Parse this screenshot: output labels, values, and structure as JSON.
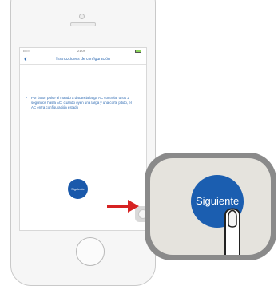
{
  "status_bar": {
    "signal": "••••○ ",
    "time": "21:09"
  },
  "nav": {
    "title": "Instrucciones de configuración"
  },
  "instruction": {
    "bullet": "•",
    "text": "Por favor, pulse el mando a distancia larga AC controlar unos 2 segundos hasta AC, cuando oyen una larga y una corte pitido, el AC entra configuración estado"
  },
  "buttons": {
    "next_small": "Siguiente",
    "next_large": "Siguiente"
  },
  "colors": {
    "accent": "#1a59ab",
    "arrow": "#d62222"
  },
  "icons": [
    "back-icon",
    "battery-icon",
    "assistive-touch-icon",
    "home-button",
    "arrow-right-icon",
    "finger-icon"
  ]
}
